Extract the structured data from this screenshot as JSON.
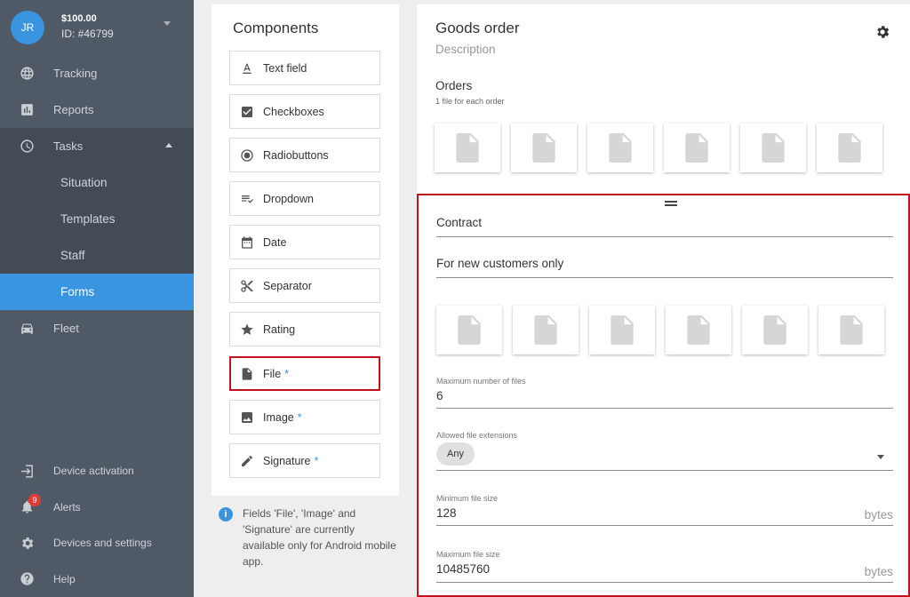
{
  "account": {
    "initials": "JR",
    "balance": "$100.00",
    "id": "ID: #46799"
  },
  "nav": {
    "tracking": "Tracking",
    "reports": "Reports",
    "tasks": "Tasks",
    "situation": "Situation",
    "templates": "Templates",
    "staff": "Staff",
    "forms": "Forms",
    "fleet": "Fleet",
    "device_activation": "Device activation",
    "alerts": "Alerts",
    "alerts_count": "9",
    "devices_settings": "Devices and settings",
    "help": "Help"
  },
  "components": {
    "title": "Components",
    "items": [
      {
        "label": "Text field",
        "icon": "text-field-icon",
        "star": ""
      },
      {
        "label": "Checkboxes",
        "icon": "checkbox-icon",
        "star": ""
      },
      {
        "label": "Radiobuttons",
        "icon": "radio-icon",
        "star": ""
      },
      {
        "label": "Dropdown",
        "icon": "dropdown-icon",
        "star": ""
      },
      {
        "label": "Date",
        "icon": "calendar-icon",
        "star": ""
      },
      {
        "label": "Separator",
        "icon": "scissors-icon",
        "star": ""
      },
      {
        "label": "Rating",
        "icon": "star-icon",
        "star": ""
      },
      {
        "label": "File",
        "icon": "file-icon",
        "star": "*"
      },
      {
        "label": "Image",
        "icon": "image-icon",
        "star": "*"
      },
      {
        "label": "Signature",
        "icon": "pen-icon",
        "star": "*"
      }
    ],
    "note": "Fields 'File', 'Image' and 'Signature' are currently available only for Android mobile app."
  },
  "form": {
    "title": "Goods order",
    "description": "Description",
    "orders": {
      "title": "Orders",
      "subtitle": "1 file for each order"
    },
    "contract_field": "Contract",
    "description_field": "For new customers only",
    "max_files": {
      "label": "Maximum number of files",
      "value": "6"
    },
    "extensions": {
      "label": "Allowed file extensions",
      "value": "Any"
    },
    "min_size": {
      "label": "Minimum file size",
      "value": "128",
      "unit": "bytes"
    },
    "max_size": {
      "label": "Maximum file size",
      "value": "10485760",
      "unit": "bytes"
    }
  },
  "colors": {
    "accent": "#3a94e0",
    "sidebar": "#505966",
    "selection": "#c1121f"
  }
}
